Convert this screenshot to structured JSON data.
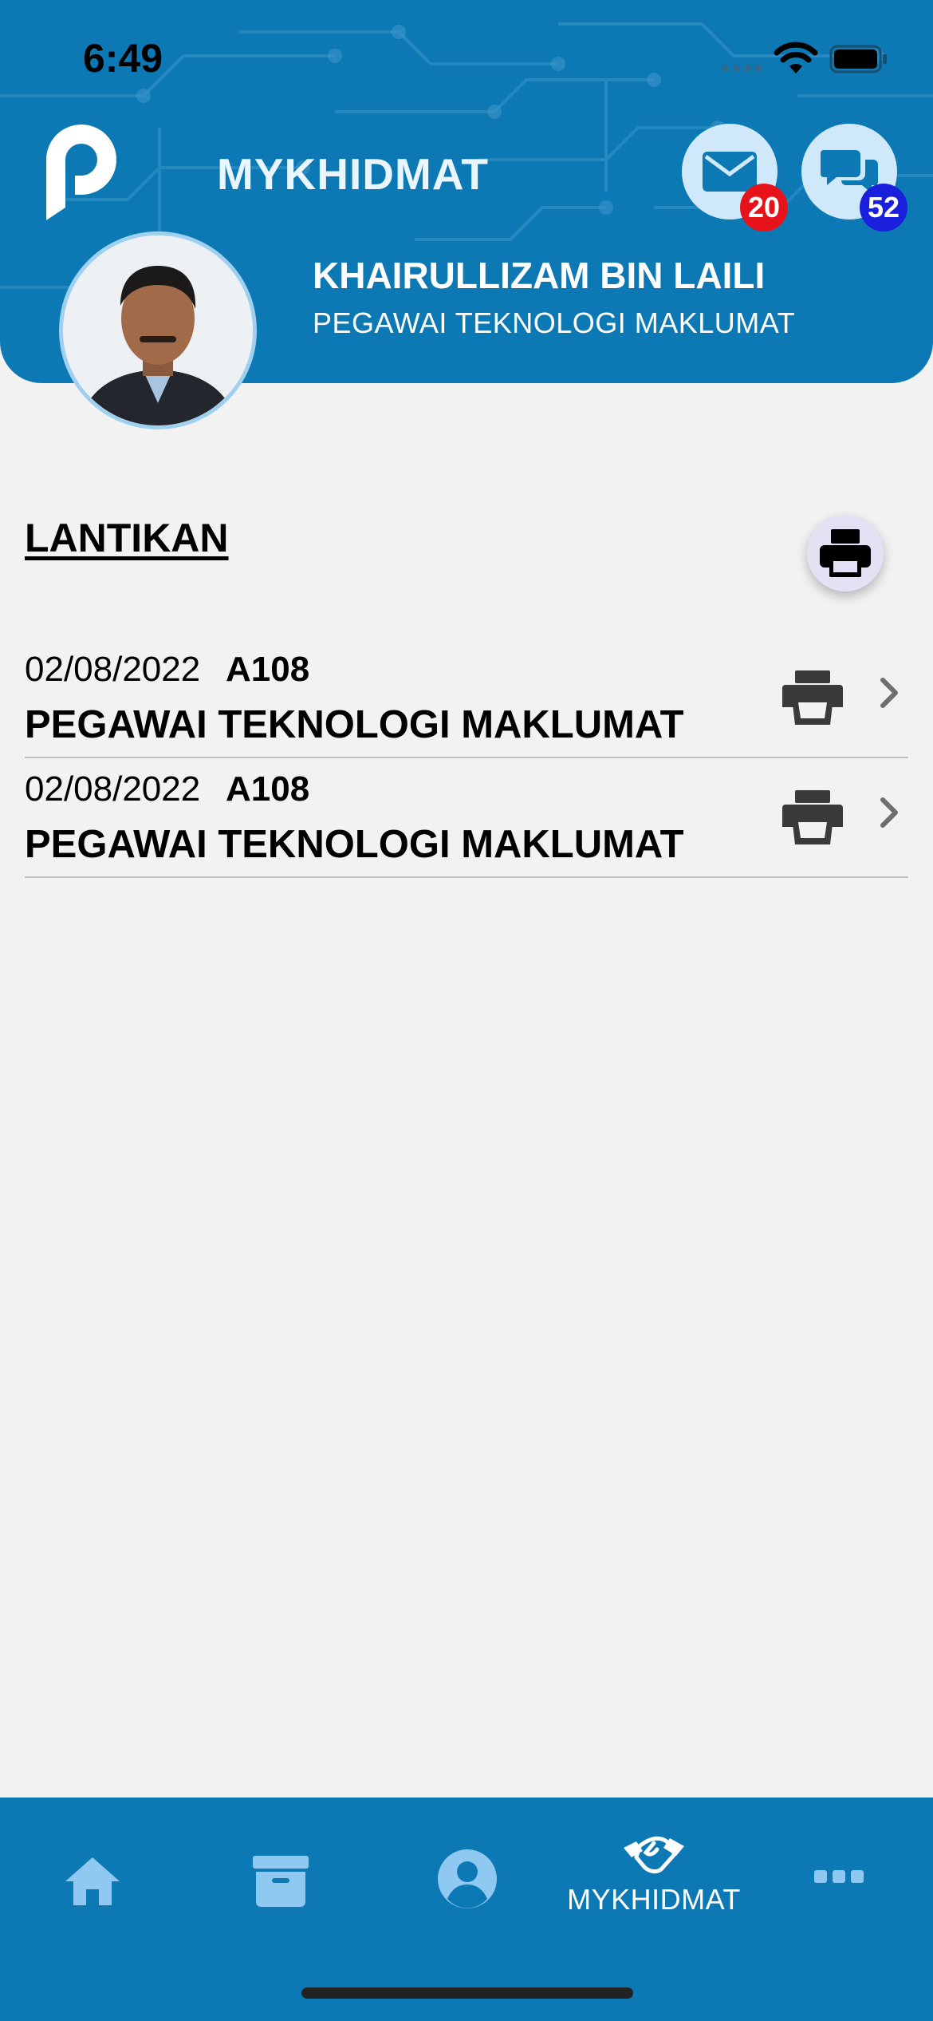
{
  "status_bar": {
    "time": "6:49"
  },
  "header": {
    "app_title": "MYKHIDMAT",
    "mail_badge": "20",
    "chat_badge": "52",
    "user_name": "KHAIRULLIZAM BIN LAILI",
    "user_position": "PEGAWAI TEKNOLOGI MAKLUMAT"
  },
  "section": {
    "title": "LANTIKAN"
  },
  "appointments": [
    {
      "date": "02/08/2022",
      "code": "A108",
      "position": "PEGAWAI TEKNOLOGI MAKLUMAT"
    },
    {
      "date": "02/08/2022",
      "code": "A108",
      "position": "PEGAWAI TEKNOLOGI MAKLUMAT"
    }
  ],
  "bottom_nav": {
    "items": [
      {
        "icon": "home-icon",
        "label": ""
      },
      {
        "icon": "archive-icon",
        "label": ""
      },
      {
        "icon": "profile-icon",
        "label": ""
      },
      {
        "icon": "handshake-icon",
        "label": "MYKHIDMAT"
      },
      {
        "icon": "more-icon",
        "label": ""
      }
    ]
  },
  "colors": {
    "primary": "#0d79b4",
    "badge_red": "#e8121a",
    "badge_blue": "#1a1fdc",
    "background": "#f2f2f2",
    "icon_light": "#cfe9fb"
  }
}
